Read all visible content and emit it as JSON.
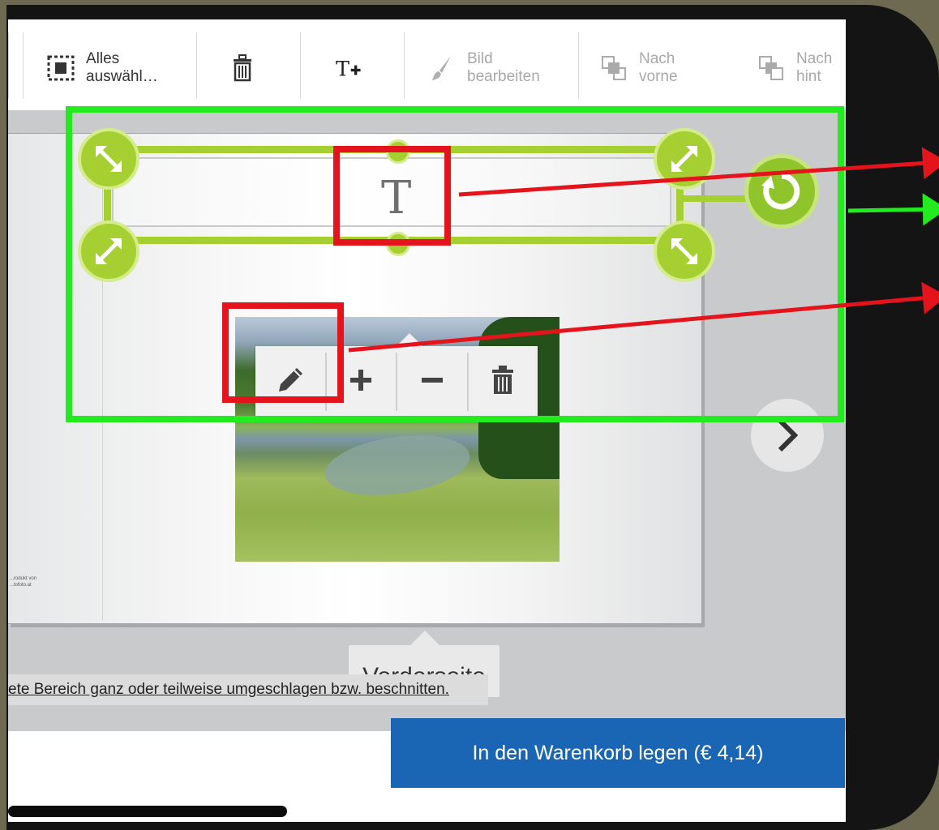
{
  "toolbar": {
    "select_all_label": "Alles\nauswähl…",
    "delete_label": "",
    "add_text_label": "",
    "edit_image_label": "Bild\nbearbeiten",
    "bring_forward_label": "Nach\nvorne",
    "send_backward_label": "Nach\nhint"
  },
  "editor": {
    "text_placeholder_glyph": "T",
    "photo_menu": {
      "items": [
        "pencil-icon",
        "plus-icon",
        "minus-icon",
        "trash-icon"
      ]
    },
    "back_cover_note": "...rodukt von\n...tofoto.at",
    "page_label": "Vorderseite",
    "hint_text": "ete Bereich ganz oder teilweise umgeschlagen bzw. beschnitten."
  },
  "cart": {
    "button_label": "In den Warenkorb legen (€ 4,14)"
  },
  "colors": {
    "selection_green": "#a6cf32",
    "annotation_green": "#23ec1e",
    "annotation_red": "#e5141c",
    "cart_blue": "#1b66b4"
  }
}
